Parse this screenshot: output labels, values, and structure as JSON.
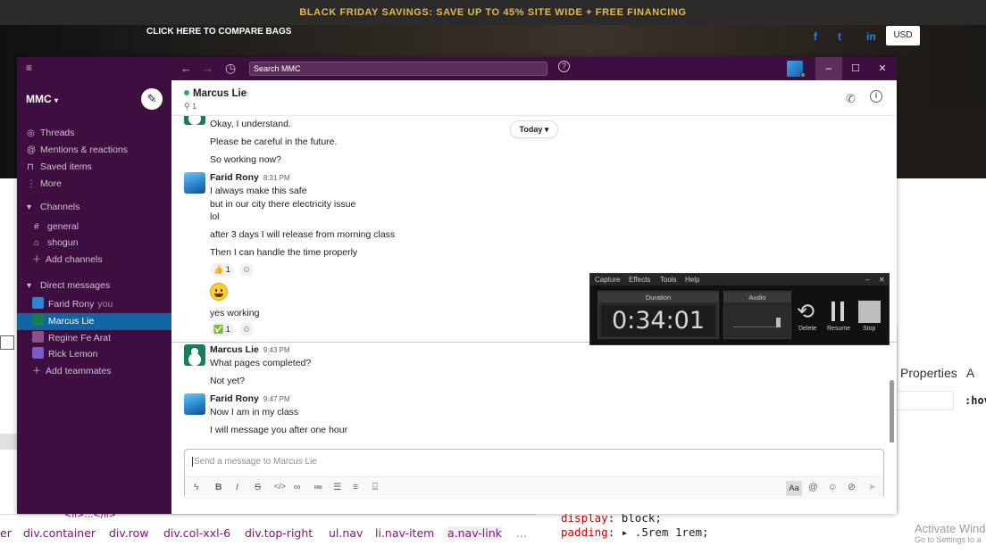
{
  "site": {
    "promo": "BLACK FRIDAY SAVINGS: SAVE UP TO 45% SITE WIDE + FREE FINANCING",
    "compare_link": "CLICK HERE TO COMPARE BAGS",
    "social": [
      "f",
      "t",
      "in"
    ],
    "currency": "USD"
  },
  "devtools": {
    "breadcrumbs": [
      "er",
      "div.container",
      "div.row",
      "div.col-xxl-6",
      "div.top-right",
      "ul.nav",
      "li.nav-item",
      "a.nav-link",
      "..."
    ],
    "truncated_crumb": "<li>…</li>",
    "css_lines": [
      {
        "prop": "display",
        "value": "block;"
      },
      {
        "prop": "padding",
        "value": "▸ .5rem 1rem;"
      }
    ],
    "properties_tab": "Properties",
    "properties_tab_cut": "A",
    "hov_label": ":hov",
    "activate_windows": "Activate Wind",
    "activate_windows_sub": "Go to Settings to a"
  },
  "slack": {
    "search_placeholder": "Search MMC",
    "workspace": "MMC",
    "sidebar": {
      "nav": [
        {
          "icon": "threads-icon",
          "glyph": "◎",
          "label": "Threads"
        },
        {
          "icon": "mentions-icon",
          "glyph": "@",
          "label": "Mentions & reactions"
        },
        {
          "icon": "bookmark-icon",
          "glyph": "⊓",
          "label": "Saved items"
        },
        {
          "icon": "more-icon",
          "glyph": "⋮",
          "label": "More"
        }
      ],
      "channels_header": "Channels",
      "channels": [
        {
          "prefix": "#",
          "label": "general"
        },
        {
          "prefix": "⌂",
          "label": "shogun"
        }
      ],
      "add_channels": "Add channels",
      "dm_header": "Direct messages",
      "dms": [
        {
          "label": "Farid Rony",
          "suffix": "you",
          "color": "#2b86cf"
        },
        {
          "label": "Marcus Lie",
          "suffix": "",
          "color": "#1b7c5a"
        },
        {
          "label": "Regine Fe Arat",
          "suffix": "",
          "color": "#8e4f8f"
        },
        {
          "label": "Rick Lemon",
          "suffix": "",
          "color": "#7a5cc7"
        }
      ],
      "add_teammates": "Add teammates"
    },
    "header": {
      "name": "Marcus Lie",
      "pins": "1"
    },
    "today": "Today",
    "messages": {
      "l1": "Okay, I understand.",
      "l2": "Please be careful in the future.",
      "l3": "So working now?",
      "farid1_author": "Farid Rony",
      "farid1_time": "8:31 PM",
      "farid1_lines": [
        "I always make this safe",
        "but in our city there electricity issue",
        "lol"
      ],
      "l4": "after 3 days I will release from morning class",
      "l5": "Then I can handle the time properly",
      "react1": "👍 1",
      "l6": "yes working",
      "react2": "✅ 1",
      "marcus_author": "Marcus Lie",
      "marcus_time": "9:43 PM",
      "marcus_line1": "What pages completed?",
      "marcus_line2": "Not yet?",
      "farid2_author": "Farid Rony",
      "farid2_time": "9:47 PM",
      "farid2_line1": "Now I am in my class",
      "farid2_line2": "I will message you after one hour"
    },
    "composer_placeholder": "Send a message to Marcus Lie",
    "composer_aa": "Aa"
  },
  "recorder": {
    "menu": [
      "Capture",
      "Effects",
      "Tools",
      "Help"
    ],
    "duration_label": "Duration",
    "duration": "0:34:01",
    "audio_label": "Audio",
    "buttons": [
      "Delete",
      "Resume",
      "Stop"
    ]
  }
}
